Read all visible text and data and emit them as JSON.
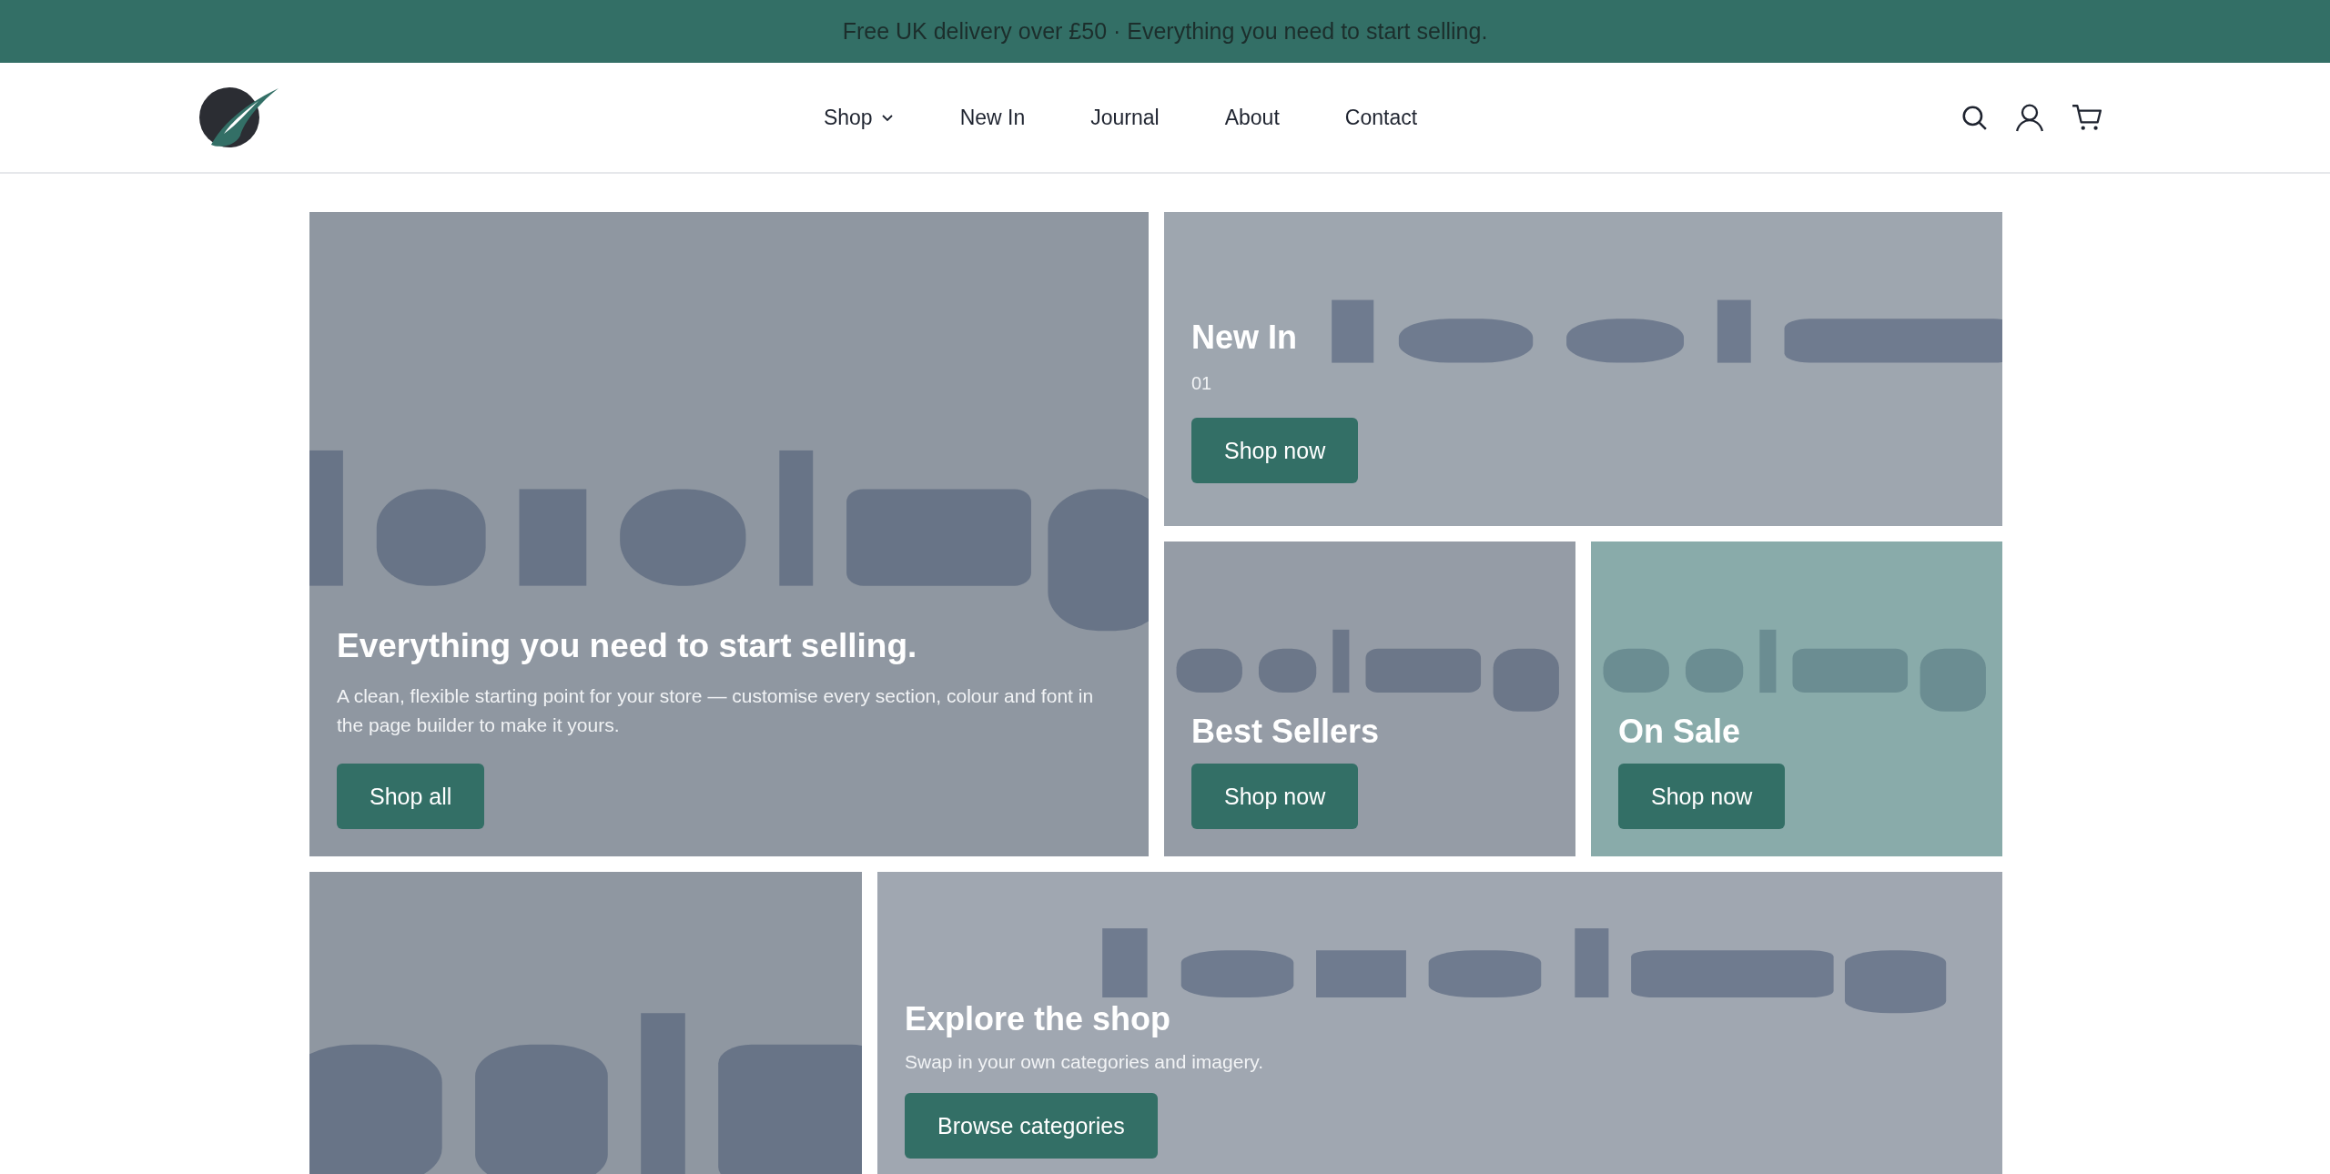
{
  "announcement": "Free UK delivery over £50 · Everything you need to start selling.",
  "nav": [
    {
      "label": "Shop",
      "dropdown": true
    },
    {
      "label": "New In",
      "dropdown": false
    },
    {
      "label": "Journal",
      "dropdown": false
    },
    {
      "label": "About",
      "dropdown": false
    },
    {
      "label": "Contact",
      "dropdown": false
    }
  ],
  "hero": {
    "title": "Everything you need to start selling.",
    "text": "A clean, flexible starting point for your store — customise every section, colour and font in the page builder to make it yours.",
    "button": "Shop all"
  },
  "tiles": [
    {
      "title": "New In",
      "count": "01",
      "button": "Shop now"
    },
    {
      "title": "Best Sellers",
      "button": "Shop now"
    },
    {
      "title": "On Sale",
      "button": "Shop now"
    }
  ],
  "bottom": {
    "title": "Explore the shop",
    "text": "Swap in your own categories and imagery.",
    "button": "Browse categories"
  }
}
